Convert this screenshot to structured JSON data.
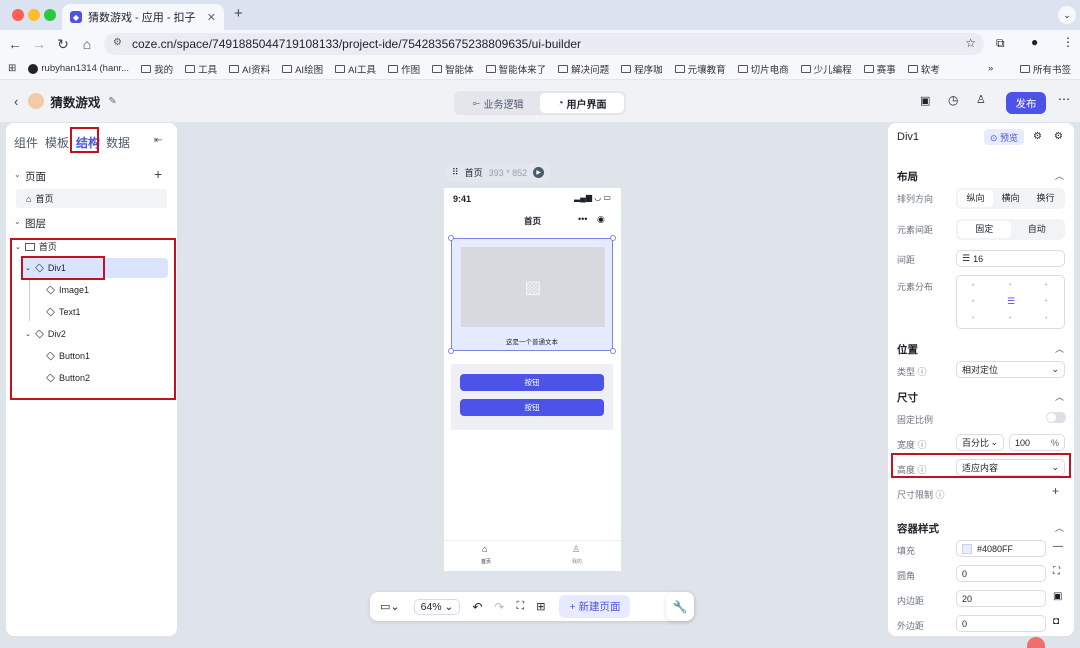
{
  "browser": {
    "tab_title": "猜数游戏 - 应用 - 扣子",
    "url": "coze.cn/space/7491885044719108133/project-ide/7542835675238809635/ui-builder",
    "bookmarks": [
      "rubyhan1314 (hanr...",
      "我的",
      "工具",
      "AI资料",
      "AI绘图",
      "AI工具",
      "作图",
      "智能体",
      "智能体来了",
      "解决问题",
      "程序咖",
      "元壤教育",
      "切片电商",
      "少儿编程",
      "赛事",
      "软考"
    ],
    "all_bookmarks": "所有书签",
    "more": "»"
  },
  "app": {
    "title": "猜数游戏",
    "tabs": [
      "业务逻辑",
      "用户界面"
    ],
    "publish": "发布"
  },
  "left": {
    "tabs": [
      "组件",
      "模板",
      "结构",
      "数据"
    ],
    "pages_label": "页面",
    "page_item": "首页",
    "layers_label": "图层",
    "tree": [
      "首页",
      "Div1",
      "Image1",
      "Text1",
      "Div2",
      "Button1",
      "Button2"
    ]
  },
  "canvas": {
    "page_name": "首页",
    "size": "393 * 852",
    "time": "9:41",
    "nav_title": "首页",
    "text": "这是一个普通文本",
    "buttons": [
      "按钮",
      "按钮"
    ],
    "tabbar": [
      "首页",
      "我的"
    ],
    "zoom": "64%",
    "new_page": "新建页面"
  },
  "right": {
    "element": "Div1",
    "preview": "预览",
    "layout": "布局",
    "direction_label": "排列方向",
    "direction_opts": [
      "纵向",
      "横向",
      "换行"
    ],
    "spacing_mode_label": "元素间距",
    "spacing_modes": [
      "固定",
      "自动"
    ],
    "gap_label": "间距",
    "gap": "16",
    "distribution_label": "元素分布",
    "position": "位置",
    "type_label": "类型",
    "type_value": "相对定位",
    "size": "尺寸",
    "ratio_label": "固定比例",
    "width_label": "宽度",
    "width_unit": "百分比",
    "width_value": "100",
    "width_suffix": "%",
    "height_label": "高度",
    "height_value": "适应内容",
    "limit_label": "尺寸限制",
    "container": "容器样式",
    "fill_label": "填充",
    "fill_value": "#4080FF",
    "radius_label": "圆角",
    "radius_value": "0",
    "padding_label": "内边距",
    "padding_value": "20",
    "margin_label": "外边距",
    "margin_value": "0"
  },
  "colors": {
    "accent": "#4d53e8",
    "highlight_red": "#c1121f",
    "selection": "#dbe4ff"
  }
}
